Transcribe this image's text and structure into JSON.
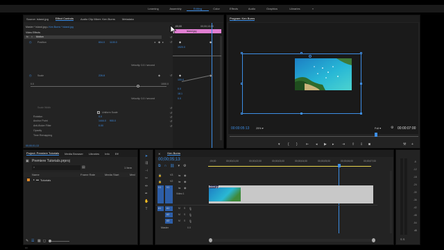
{
  "workspaces": {
    "items": [
      "Learning",
      "Assembly",
      "Editing",
      "Color",
      "Effects",
      "Audio",
      "Graphics",
      "Libraries"
    ],
    "more": "»"
  },
  "source_tabs": {
    "tabs": [
      "Source: island.jpg",
      "Effect Controls",
      "Audio Clip Mixer: Ken Burns",
      "Metadata"
    ],
    "active_index": 1
  },
  "effect_controls": {
    "breadcrumb": {
      "master": "Master * island.jpg",
      "clip": "Ken Burns * island.jpg"
    },
    "ruler_start": ";00;00",
    "ruler_end": "00;00;10;00",
    "clip_name": "island.jpg",
    "section": "Video Effects",
    "motion": "Motion",
    "position": {
      "label": "Position",
      "x": "604.0",
      "y": "1100.0"
    },
    "position_graph": {
      "max": "1920.0",
      "velocity": "Velocity: 0.0 / second"
    },
    "scale": {
      "label": "Scale",
      "value": "226.8"
    },
    "scale_graph": {
      "left": "0.0",
      "right": "1000.0",
      "top": "100.0",
      "a": "0.0",
      "b": "18.1",
      "c": "0.0",
      "velocity": "Velocity: 0.0 / second"
    },
    "scale_width": "Scale Width",
    "uniform_scale": "Uniform Scale",
    "rotation": {
      "label": "Rotation",
      "value": "0.0"
    },
    "anchor": {
      "label": "Anchor Point",
      "x": "1444.0",
      "y": "900.0"
    },
    "antiflicker": {
      "label": "Anti-flicker Filter",
      "value": "0.00"
    },
    "opacity": "Opacity",
    "time_remap": "Time Remapping",
    "timecode": "00;00;01;13"
  },
  "program_monitor": {
    "title": "Program: Ken Burns",
    "timecode": "00:00:05:13",
    "zoom": "25%",
    "quality": "Full",
    "duration": "00:00:07:00"
  },
  "project": {
    "tabs": [
      "Project: Premiere Tutorials",
      "Media Browser",
      "Libraries",
      "Info",
      "Eff"
    ],
    "file": "Premiere Tutorials.prproj",
    "items_count": "1 Item",
    "columns": {
      "name": "Name",
      "frame_rate": "Frame Rate",
      "media_start": "Media Start",
      "media_end": "Med"
    },
    "bin": "Tutorials"
  },
  "timeline": {
    "tab": "Ken Burns",
    "timecode": "00;00;05;13",
    "ruler": [
      ";00;00",
      "00;00;01;00",
      "00;00;02;00",
      "00;00;03;00",
      "00;00;04;00",
      "00;00;05;00",
      "00;00;06;00",
      "00;00;07;00"
    ],
    "video_tracks": [
      "V3",
      "V2",
      "V1"
    ],
    "audio_tracks": [
      "A1",
      "A2",
      "A3"
    ],
    "source_v": "V1",
    "source_a": "A1",
    "track_name_v1": "Video 1",
    "clip": "island.jpg",
    "master": "Master",
    "master_level": "0.0",
    "meter_labels": [
      "-6",
      "-12",
      "-18",
      "-24",
      "-30",
      "-36",
      "-42",
      "-48",
      "-54",
      "dB"
    ],
    "meter_bottom": "S S"
  }
}
